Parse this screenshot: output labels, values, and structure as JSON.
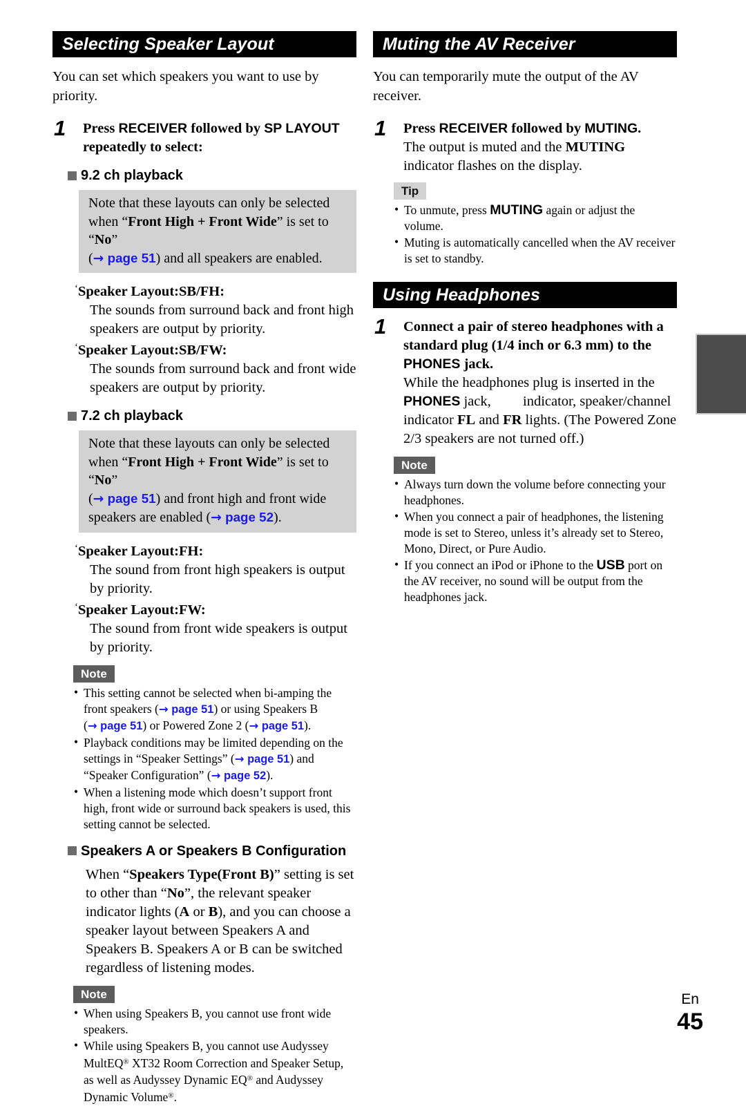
{
  "left_column": {
    "section1": {
      "header": "Selecting Speaker Layout",
      "intro": "You can set which speakers you want to use by priority.",
      "step": {
        "number": "1",
        "title_part1": "Press ",
        "title_key1": "RECEIVER",
        "title_part2": " followed by ",
        "title_key2": "SP LAYOUT",
        "title_part3": "",
        "title_line2": "repeatedly to select:"
      },
      "sub1": {
        "heading": "9.2 ch playback",
        "note_box": {
          "line1": "Note that these layouts can only be selected",
          "line2_pre": "when “",
          "line2_bold": "Front High + Front Wide",
          "line2_mid": "” is set to “",
          "line2_bold2": "No",
          "line2_post": "”",
          "line3_pre": "(",
          "line3_ref": "→ page 51",
          "line3_post": ") and all speakers are enabled."
        },
        "items": [
          {
            "term": "Speaker Layout:SB/FH",
            "desc": "The sounds from surround back and front high speakers are output by priority."
          },
          {
            "term": "Speaker Layout:SB/FW",
            "desc": "The sounds from surround back and front wide speakers are output by priority."
          }
        ]
      },
      "sub2": {
        "heading": "7.2 ch playback",
        "note_box": {
          "line1": "Note that these layouts can only be selected",
          "line2_pre": "when “",
          "line2_bold": "Front High + Front Wide",
          "line2_mid": "” is set to “",
          "line2_bold2": "No",
          "line2_post": "”",
          "line3_pre": "(",
          "line3_ref": "→ page 51",
          "line3_mid": ") and front high and front wide speakers are enabled (",
          "line3_ref2": "→ page 52",
          "line3_post": ")."
        },
        "items": [
          {
            "term": "Speaker Layout:FH",
            "desc": "The sound from front high speakers is output by priority."
          },
          {
            "term": "Speaker Layout:FW",
            "desc": "The sound from front wide speakers is output by priority."
          }
        ]
      },
      "note1": {
        "badge": "Note",
        "bullets": [
          {
            "p1": "This setting cannot be selected when bi-amping the front speakers (",
            "r1": "→ page 51",
            "p2": ") or using Speakers B (",
            "r2": "→ page 51",
            "p3": ") or Powered Zone 2 (",
            "r3": "→ page 51",
            "p4": ")."
          },
          {
            "p1": "Playback conditions may be limited depending on the settings in “Speaker Settings” (",
            "r1": "→ page 51",
            "p2": ") and “Speaker Configuration” (",
            "r2": "→ page 52",
            "p3": ")."
          },
          {
            "p1": "When a listening mode which doesn’t support front high, front wide or surround back speakers is used, this setting cannot be selected."
          }
        ]
      },
      "sub3": {
        "heading": "Speakers A or Speakers B Configuration",
        "body_pre": "When “",
        "body_bold": "Speakers Type(Front B)",
        "body_mid": "” setting is set to other than “",
        "body_bold2": "No",
        "body_mid2": "”, the relevant speaker indicator lights (",
        "body_bold3": "A",
        "body_mid3": " or ",
        "body_bold4": "B",
        "body_post": "), and you can choose a speaker layout between Speakers A and Speakers B. Speakers A or B can be switched regardless of listening modes."
      },
      "note2": {
        "badge": "Note",
        "bullets": [
          {
            "p1": "When using Speakers B, you cannot use front wide speakers."
          },
          {
            "p1": "While using Speakers B, you cannot use Audyssey MultEQ® XT32 Room Correction and Speaker Setup, as well as Audyssey Dynamic EQ® and Audyssey Dynamic Volume®."
          }
        ]
      }
    }
  },
  "right_column": {
    "section2": {
      "header": "Muting the AV Receiver",
      "intro": "You can temporarily mute the output of the AV receiver.",
      "step": {
        "number": "1",
        "title_part1": "Press ",
        "title_key1": "RECEIVER",
        "title_part2": " followed by ",
        "title_key2": "MUTING",
        "title_part3": ".",
        "body_pre": "The output is muted and the ",
        "body_key": "MUTING",
        "body_post": " indicator flashes on the display."
      },
      "tip": {
        "badge": "Tip",
        "bullets": [
          {
            "p1": "To unmute, press ",
            "k1": "MUTING",
            "p2": " again or adjust the volume."
          },
          {
            "p1": "Muting is automatically cancelled when the AV receiver is set to standby."
          }
        ]
      }
    },
    "section3": {
      "header": "Using Headphones",
      "step": {
        "number": "1",
        "title_line1": "Connect a pair of stereo headphones with a",
        "title_line2": "standard plug (1/4 inch or 6.3 mm) to the",
        "title_key": "PHONES",
        "title_line3": " jack.",
        "body_pre": "While the headphones plug is inserted in the ",
        "body_key": "PHONES",
        "body_mid": " jack, ",
        "body_icon": "headphone-indicator-icon",
        "body_mid2": " indicator, speaker/channel indicator ",
        "body_key2": "FL",
        "body_mid3": " and ",
        "body_key3": "FR",
        "body_post": " lights. (The Powered Zone 2/3 speakers are not turned off.)"
      },
      "note": {
        "badge": "Note",
        "bullets": [
          {
            "p1": "Always turn down the volume before connecting your headphones."
          },
          {
            "p1": "When you connect a pair of headphones, the listening mode is set to Stereo, unless it’s already set to Stereo, Mono, Direct, or Pure Audio."
          },
          {
            "p1": "If you connect an iPod or iPhone to the ",
            "k1": "USB",
            "p2": " port on the AV receiver, no sound will be output from the headphones jack."
          }
        ]
      }
    }
  },
  "footer": {
    "language": "En",
    "page_number": "45"
  },
  "colors": {
    "header_bar_bg": "#000000",
    "header_bar_text": "#ffffff",
    "note_badge_bg": "#5d5d5d",
    "tip_badge_bg": "#d2d2d2",
    "gray_box_bg": "#d2d2d2",
    "page_ref_blue": "#1a1ae6",
    "square_bullet": "#6b6b6b",
    "thumb_tab": "#4c4c4c"
  }
}
